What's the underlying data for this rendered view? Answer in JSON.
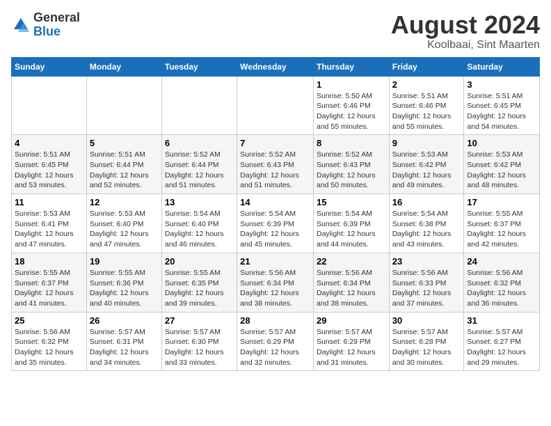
{
  "logo": {
    "general": "General",
    "blue": "Blue"
  },
  "title": "August 2024",
  "location": "Koolbaai, Sint Maarten",
  "days_of_week": [
    "Sunday",
    "Monday",
    "Tuesday",
    "Wednesday",
    "Thursday",
    "Friday",
    "Saturday"
  ],
  "weeks": [
    [
      {
        "day": "",
        "content": ""
      },
      {
        "day": "",
        "content": ""
      },
      {
        "day": "",
        "content": ""
      },
      {
        "day": "",
        "content": ""
      },
      {
        "day": "1",
        "content": "Sunrise: 5:50 AM\nSunset: 6:46 PM\nDaylight: 12 hours and 55 minutes."
      },
      {
        "day": "2",
        "content": "Sunrise: 5:51 AM\nSunset: 6:46 PM\nDaylight: 12 hours and 55 minutes."
      },
      {
        "day": "3",
        "content": "Sunrise: 5:51 AM\nSunset: 6:45 PM\nDaylight: 12 hours and 54 minutes."
      }
    ],
    [
      {
        "day": "4",
        "content": "Sunrise: 5:51 AM\nSunset: 6:45 PM\nDaylight: 12 hours and 53 minutes."
      },
      {
        "day": "5",
        "content": "Sunrise: 5:51 AM\nSunset: 6:44 PM\nDaylight: 12 hours and 52 minutes."
      },
      {
        "day": "6",
        "content": "Sunrise: 5:52 AM\nSunset: 6:44 PM\nDaylight: 12 hours and 51 minutes."
      },
      {
        "day": "7",
        "content": "Sunrise: 5:52 AM\nSunset: 6:43 PM\nDaylight: 12 hours and 51 minutes."
      },
      {
        "day": "8",
        "content": "Sunrise: 5:52 AM\nSunset: 6:43 PM\nDaylight: 12 hours and 50 minutes."
      },
      {
        "day": "9",
        "content": "Sunrise: 5:53 AM\nSunset: 6:42 PM\nDaylight: 12 hours and 49 minutes."
      },
      {
        "day": "10",
        "content": "Sunrise: 5:53 AM\nSunset: 6:42 PM\nDaylight: 12 hours and 48 minutes."
      }
    ],
    [
      {
        "day": "11",
        "content": "Sunrise: 5:53 AM\nSunset: 6:41 PM\nDaylight: 12 hours and 47 minutes."
      },
      {
        "day": "12",
        "content": "Sunrise: 5:53 AM\nSunset: 6:40 PM\nDaylight: 12 hours and 47 minutes."
      },
      {
        "day": "13",
        "content": "Sunrise: 5:54 AM\nSunset: 6:40 PM\nDaylight: 12 hours and 46 minutes."
      },
      {
        "day": "14",
        "content": "Sunrise: 5:54 AM\nSunset: 6:39 PM\nDaylight: 12 hours and 45 minutes."
      },
      {
        "day": "15",
        "content": "Sunrise: 5:54 AM\nSunset: 6:39 PM\nDaylight: 12 hours and 44 minutes."
      },
      {
        "day": "16",
        "content": "Sunrise: 5:54 AM\nSunset: 6:38 PM\nDaylight: 12 hours and 43 minutes."
      },
      {
        "day": "17",
        "content": "Sunrise: 5:55 AM\nSunset: 6:37 PM\nDaylight: 12 hours and 42 minutes."
      }
    ],
    [
      {
        "day": "18",
        "content": "Sunrise: 5:55 AM\nSunset: 6:37 PM\nDaylight: 12 hours and 41 minutes."
      },
      {
        "day": "19",
        "content": "Sunrise: 5:55 AM\nSunset: 6:36 PM\nDaylight: 12 hours and 40 minutes."
      },
      {
        "day": "20",
        "content": "Sunrise: 5:55 AM\nSunset: 6:35 PM\nDaylight: 12 hours and 39 minutes."
      },
      {
        "day": "21",
        "content": "Sunrise: 5:56 AM\nSunset: 6:34 PM\nDaylight: 12 hours and 38 minutes."
      },
      {
        "day": "22",
        "content": "Sunrise: 5:56 AM\nSunset: 6:34 PM\nDaylight: 12 hours and 38 minutes."
      },
      {
        "day": "23",
        "content": "Sunrise: 5:56 AM\nSunset: 6:33 PM\nDaylight: 12 hours and 37 minutes."
      },
      {
        "day": "24",
        "content": "Sunrise: 5:56 AM\nSunset: 6:32 PM\nDaylight: 12 hours and 36 minutes."
      }
    ],
    [
      {
        "day": "25",
        "content": "Sunrise: 5:56 AM\nSunset: 6:32 PM\nDaylight: 12 hours and 35 minutes."
      },
      {
        "day": "26",
        "content": "Sunrise: 5:57 AM\nSunset: 6:31 PM\nDaylight: 12 hours and 34 minutes."
      },
      {
        "day": "27",
        "content": "Sunrise: 5:57 AM\nSunset: 6:30 PM\nDaylight: 12 hours and 33 minutes."
      },
      {
        "day": "28",
        "content": "Sunrise: 5:57 AM\nSunset: 6:29 PM\nDaylight: 12 hours and 32 minutes."
      },
      {
        "day": "29",
        "content": "Sunrise: 5:57 AM\nSunset: 6:29 PM\nDaylight: 12 hours and 31 minutes."
      },
      {
        "day": "30",
        "content": "Sunrise: 5:57 AM\nSunset: 6:28 PM\nDaylight: 12 hours and 30 minutes."
      },
      {
        "day": "31",
        "content": "Sunrise: 5:57 AM\nSunset: 6:27 PM\nDaylight: 12 hours and 29 minutes."
      }
    ]
  ]
}
